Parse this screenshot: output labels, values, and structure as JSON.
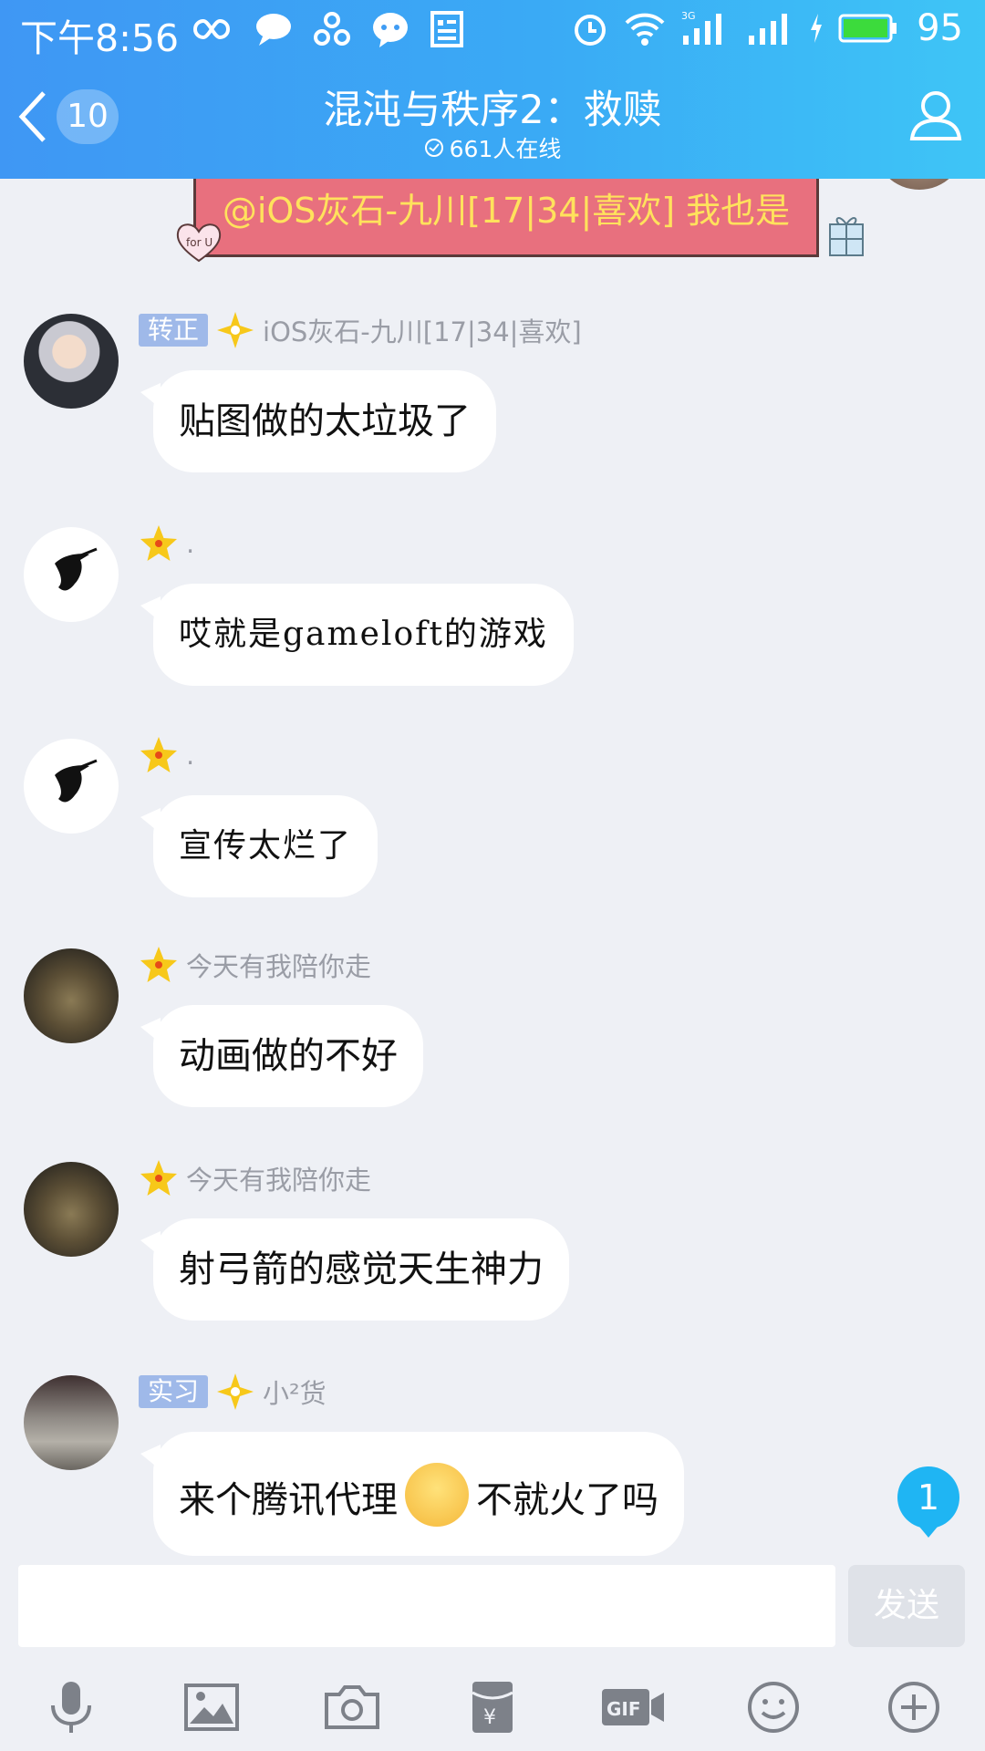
{
  "status_bar": {
    "time": "下午8:56",
    "battery": "95",
    "network_label": "3G"
  },
  "header": {
    "back_unread": "10",
    "title": "混沌与秩序2：救赎",
    "online": "661人在线"
  },
  "banner": {
    "text": "@iOS灰石-九川[17|34|喜欢] 我也是"
  },
  "messages": [
    {
      "badge": "转正",
      "name": "iOS灰石-九川[17|34|喜欢]",
      "text": "贴图做的太垃圾了"
    },
    {
      "badge": "",
      "name": ".",
      "text": "哎就是gameloft的游戏"
    },
    {
      "badge": "",
      "name": ".",
      "text": "宣传太烂了"
    },
    {
      "badge": "",
      "name": "今天有我陪你走",
      "text": "动画做的不好"
    },
    {
      "badge": "",
      "name": "今天有我陪你走",
      "text": "射弓箭的感觉天生神力"
    },
    {
      "badge": "实习",
      "name": "小²货",
      "text_before": "来个腾讯代理",
      "text_after": "不就火了吗"
    }
  ],
  "new_message_count": "1",
  "composer": {
    "placeholder": "",
    "send_label": "发送"
  },
  "toolbar": {
    "icons": [
      "microphone-icon",
      "image-icon",
      "camera-icon",
      "red-packet-icon",
      "gif-icon",
      "emoji-icon",
      "plus-icon"
    ]
  },
  "colors": {
    "header_gradient_start": "#3f97f4",
    "header_gradient_end": "#3ec5f6",
    "chat_background": "#eef0f5",
    "banner_background": "#e8707e",
    "banner_text": "#ffe25c",
    "badge_color": "#1fb5f3"
  }
}
